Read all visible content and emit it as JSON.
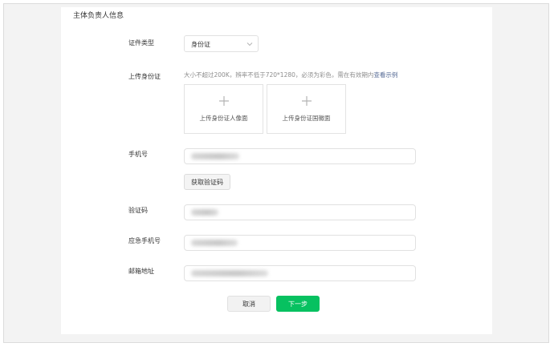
{
  "section": {
    "title": "主体负责人信息"
  },
  "id_type": {
    "label": "证件类型",
    "selected": "身份证",
    "icon": "chevron-down-icon"
  },
  "id_upload": {
    "label": "上传身份证",
    "hint": "大小不超过200K，辨率不低于720*1280，必须为彩色，需在有效期内",
    "example_link": "查看示例",
    "front_label": "上传身份证人像面",
    "back_label": "上传身份证国徽面",
    "icon": "plus-icon"
  },
  "phone": {
    "label": "手机号",
    "get_code_button": "获取验证码"
  },
  "verify_code": {
    "label": "验证码"
  },
  "emergency_phone": {
    "label": "应急手机号"
  },
  "email": {
    "label": "邮箱地址"
  },
  "actions": {
    "cancel": "取消",
    "next": "下一步"
  },
  "colors": {
    "accent": "#07c160",
    "link": "#576b95",
    "background": "#f3f3f3"
  }
}
